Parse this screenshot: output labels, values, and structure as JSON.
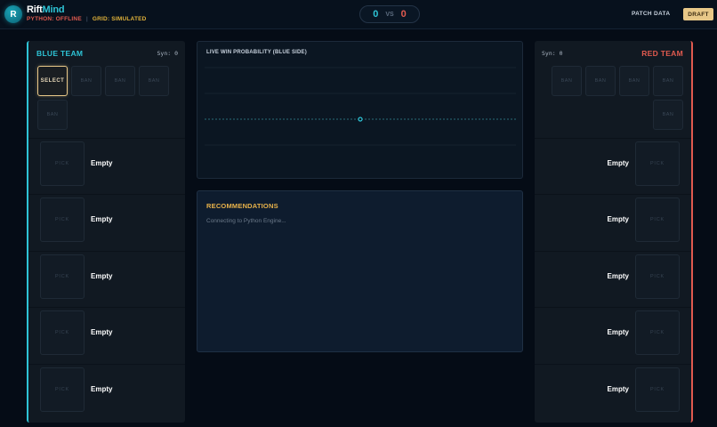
{
  "app": {
    "logo_letter": "R",
    "brand_part1": "Rift",
    "brand_part2": "Mind",
    "python_status": "PYTHON: OFFLINE",
    "separator": "|",
    "grid_status": "GRID: SIMULATED"
  },
  "score": {
    "blue": "0",
    "vs": "VS",
    "red": "0"
  },
  "header": {
    "patch_data_label": "PATCH DATA",
    "draft_label": "DRAFT"
  },
  "blue_team": {
    "title": "BLUE TEAM",
    "synergy": "Syn: 0",
    "bans": [
      "SELECT",
      "BAN",
      "BAN",
      "BAN",
      "BAN"
    ],
    "picks": [
      {
        "slot": "PICK",
        "name": "Empty"
      },
      {
        "slot": "PICK",
        "name": "Empty"
      },
      {
        "slot": "PICK",
        "name": "Empty"
      },
      {
        "slot": "PICK",
        "name": "Empty"
      },
      {
        "slot": "PICK",
        "name": "Empty"
      }
    ]
  },
  "red_team": {
    "title": "RED TEAM",
    "synergy": "Syn: 0",
    "bans": [
      "BAN",
      "BAN",
      "BAN",
      "BAN",
      "BAN"
    ],
    "picks": [
      {
        "slot": "PICK",
        "name": "Empty"
      },
      {
        "slot": "PICK",
        "name": "Empty"
      },
      {
        "slot": "PICK",
        "name": "Empty"
      },
      {
        "slot": "PICK",
        "name": "Empty"
      },
      {
        "slot": "PICK",
        "name": "Empty"
      }
    ]
  },
  "win_probability": {
    "title": "LIVE WIN PROBABILITY (BLUE SIDE)",
    "current_value": 0.5
  },
  "recommendations": {
    "title": "RECOMMENDATIONS",
    "status": "Connecting to Python Engine..."
  },
  "colors": {
    "blue_accent": "#2ec4d6",
    "red_accent": "#e05a4f",
    "gold_accent": "#e8c888",
    "rec_title": "#e8b24a"
  }
}
